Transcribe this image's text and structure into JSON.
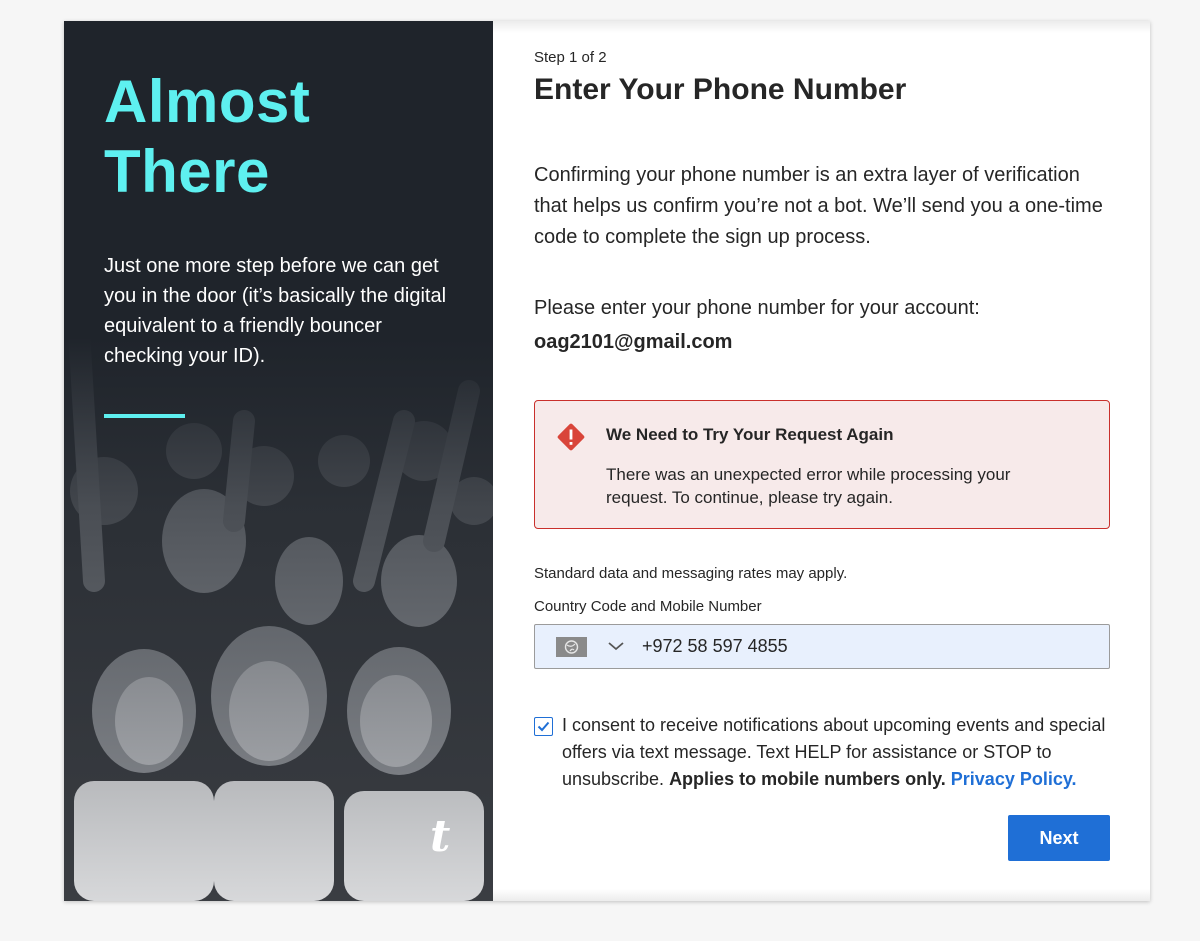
{
  "hero": {
    "title_line1": "Almost",
    "title_line2": "There",
    "description": "Just one more step before we can get you in the door (it’s basically the digital equivalent to a friendly bouncer checking your ID).",
    "brand_mark": "t"
  },
  "form": {
    "step": "Step 1 of 2",
    "heading": "Enter Your Phone Number",
    "intro": "Confirming your phone number is an extra layer of verification that helps us confirm you’re not a bot. We’ll send you a one-time code to complete the sign up process.",
    "enter_label": "Please enter your phone number for your account:",
    "email": "oag2101@gmail.com",
    "alert": {
      "title": "We Need to Try Your Request Again",
      "body": "There was an unexpected error while processing your request. To continue, please try again.",
      "icon": "warning-diamond-icon"
    },
    "rates_note": "Standard data and messaging rates may apply.",
    "phone_label": "Country Code and Mobile Number",
    "phone_value": "+972 58 597 4855",
    "consent": {
      "checked": true,
      "text": "I consent to receive notifications about upcoming events and special offers via text message. Text HELP for assistance or STOP to unsubscribe. ",
      "bold": "Applies to mobile numbers only.",
      "link": "Privacy Policy",
      "tail": "."
    },
    "next_label": "Next"
  },
  "colors": {
    "accent_cyan": "#5ef0f0",
    "primary_blue": "#1f6fd6",
    "error_red": "#c9302c",
    "error_bg": "#f7eaea",
    "dark_panel": "#1f242b"
  }
}
